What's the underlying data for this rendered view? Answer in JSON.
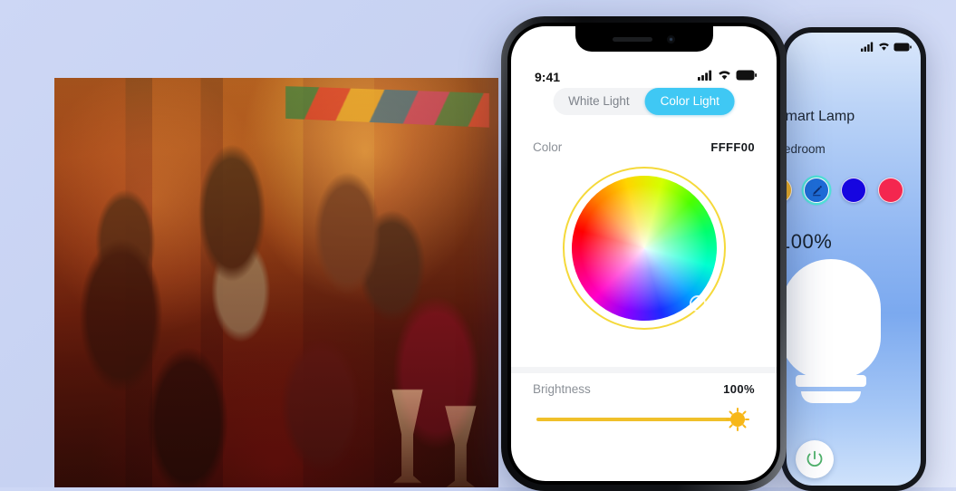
{
  "scene": {
    "background_color": "#c7d2f2",
    "photo": {
      "name": "party-celebration-photo",
      "alt_description": "Group of friends celebrating at a warm-lit party with HAPPY NEW YEAR banner"
    }
  },
  "front_phone": {
    "status_bar": {
      "time": "9:41",
      "icons": [
        "cellular-signal-icon",
        "wifi-icon",
        "battery-icon"
      ]
    },
    "segmented_control": {
      "options": [
        {
          "label": "White Light",
          "active": false
        },
        {
          "label": "Color Light",
          "active": true
        }
      ],
      "active_color": "#3fc8f4",
      "track_color": "#f2f3f5"
    },
    "color_section": {
      "label": "Color",
      "value": "FFFF00",
      "wheel": {
        "name": "color-wheel",
        "ring_color": "#f5d93a"
      }
    },
    "brightness_section": {
      "label": "Brightness",
      "value": "100%",
      "slider": {
        "percent": 100,
        "track_color": "#f0c02a",
        "handle_icon": "sun-icon"
      }
    }
  },
  "back_phone": {
    "status_bar": {
      "icons": [
        "cellular-signal-icon",
        "wifi-icon",
        "battery-icon"
      ]
    },
    "title": "Smart Lamp",
    "room": "Bedroom",
    "brightness_value": "100%",
    "swatches": [
      {
        "name": "swatch-amber",
        "color": "#f5b320",
        "selected": false,
        "icon": ""
      },
      {
        "name": "swatch-custom",
        "color": "#1e6dd8",
        "selected": true,
        "icon": "pencil-icon"
      },
      {
        "name": "swatch-blue",
        "color": "#1605e0",
        "selected": false,
        "icon": ""
      },
      {
        "name": "swatch-crimson",
        "color": "#f4274f",
        "selected": false,
        "icon": ""
      }
    ],
    "bulb_icon": "light-bulb-icon",
    "power_button": {
      "name": "power-button",
      "icon": "power-icon",
      "color": "#4fb26a"
    }
  }
}
